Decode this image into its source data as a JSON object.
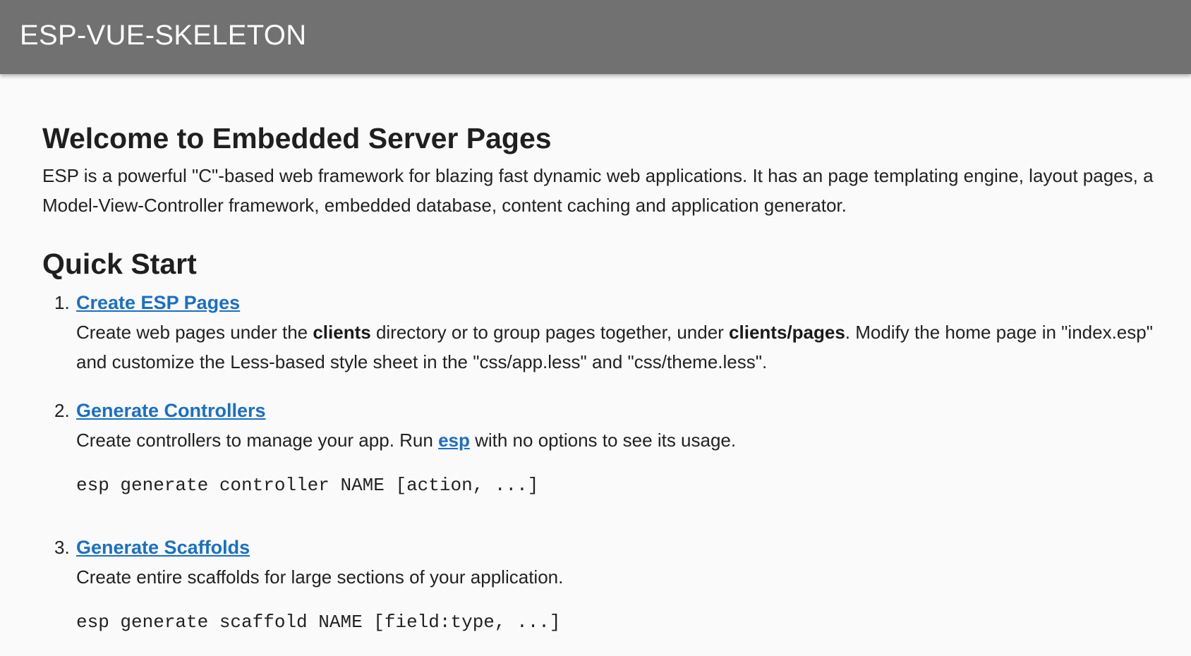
{
  "toolbar": {
    "title": "ESP-VUE-SKELETON",
    "background": "#717171"
  },
  "main": {
    "heading": "Welcome to Embedded Server Pages",
    "intro": "ESP is a powerful \"C\"-based web framework for blazing fast dynamic web applications. It has an page templating engine, layout pages, a Model-View-Controller framework, embedded database, content caching and application generator.",
    "quick_start_heading": "Quick Start",
    "link_color": "#1a6fc7",
    "steps": [
      {
        "number": "1.",
        "title": "Create ESP Pages",
        "desc_part1": "Create web pages under the ",
        "desc_bold1": "clients",
        "desc_part2": " directory or to group pages together, under ",
        "desc_bold2": "clients/pages",
        "desc_part3": ". Modify the home page in \"index.esp\" and customize the Less-based style sheet in the \"css/app.less\" and \"css/theme.less\"."
      },
      {
        "number": "2.",
        "title": "Generate Controllers",
        "desc_part1": "Create controllers to manage your app. Run ",
        "desc_link": "esp",
        "desc_part2": " with no options to see its usage.",
        "code": "esp generate controller NAME [action, ...]"
      },
      {
        "number": "3.",
        "title": "Generate Scaffolds",
        "desc_part1": "Create entire scaffolds for large sections of your application.",
        "code": "esp generate scaffold NAME [field:type, ...]"
      }
    ]
  }
}
